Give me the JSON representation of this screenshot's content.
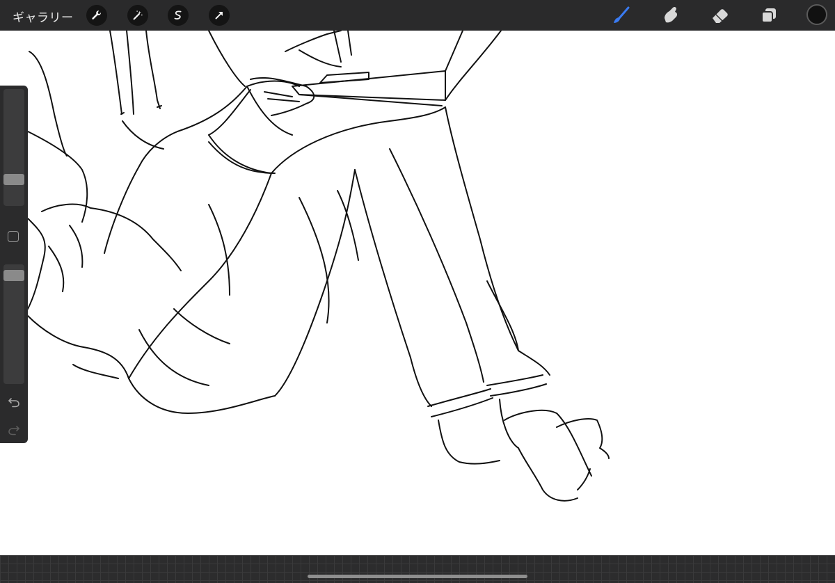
{
  "toolbar": {
    "gallery_label": "ギャラリー",
    "left_tools": [
      {
        "name": "actions",
        "icon": "wrench-icon"
      },
      {
        "name": "adjustments",
        "icon": "magic-wand-icon"
      },
      {
        "name": "selection",
        "icon": "selection-s-icon"
      },
      {
        "name": "transform",
        "icon": "arrow-cursor-icon"
      }
    ],
    "right_tools": [
      {
        "name": "brush",
        "icon": "brush-icon",
        "active": true
      },
      {
        "name": "smudge",
        "icon": "smudge-finger-icon"
      },
      {
        "name": "eraser",
        "icon": "eraser-icon"
      },
      {
        "name": "layers",
        "icon": "layers-icon"
      }
    ],
    "current_color": "#111111",
    "active_color": "#3a7bf2"
  },
  "sidebar": {
    "brush_size_level": 0.2,
    "opacity_level": 0.95,
    "undo_icon": "undo-arrow-icon",
    "redo_icon": "redo-arrow-icon",
    "modify_button_icon": "square-outline-icon"
  },
  "colors": {
    "toolbar_bg": "#2a2a2b",
    "canvas_bg": "#ffffff",
    "line_art": "#111111"
  }
}
